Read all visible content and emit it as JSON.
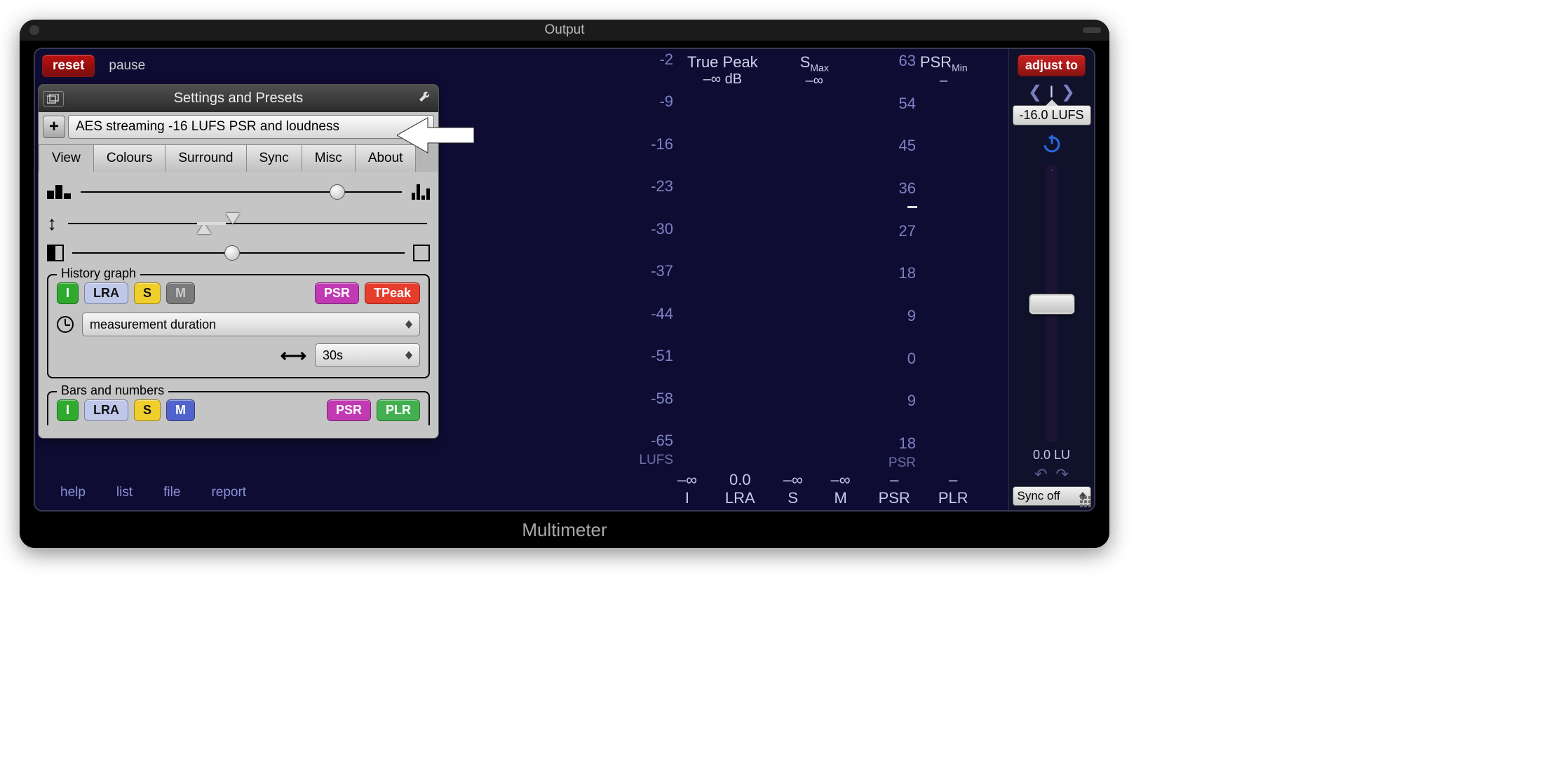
{
  "window": {
    "title": "Output",
    "footer": "Multimeter"
  },
  "top": {
    "reset": "reset",
    "pause": "pause"
  },
  "settings": {
    "header": "Settings and Presets",
    "preset": "AES streaming -16 LUFS PSR and loudness",
    "tabs": [
      "View",
      "Colours",
      "Surround",
      "Sync",
      "Misc",
      "About"
    ],
    "history_legend": "History graph",
    "bars_legend": "Bars and numbers",
    "chips1": {
      "I": "I",
      "LRA": "LRA",
      "S": "S",
      "M": "M",
      "PSR": "PSR",
      "TPeak": "TPeak"
    },
    "duration_label": "measurement duration",
    "duration_value": "30s",
    "chips2": {
      "I": "I",
      "LRA": "LRA",
      "S": "S",
      "M": "M",
      "PSR": "PSR",
      "PLR": "PLR"
    }
  },
  "stats": {
    "truepeak_label": "True Peak",
    "truepeak_value": "–∞ dB",
    "smax_label_prefix": "S",
    "smax_label_sub": "Max",
    "smax_value": "–∞",
    "psrmin_label_prefix": "PSR",
    "psrmin_label_sub": "Min",
    "psrmin_value": "–"
  },
  "axis_left": [
    "-2",
    "-9",
    "-16",
    "-23",
    "-30",
    "-37",
    "-44",
    "-51",
    "-58",
    "-65"
  ],
  "axis_left_unit": "LUFS",
  "axis_right": [
    "63",
    "54",
    "45",
    "36",
    "27",
    "18",
    "9",
    "0",
    "9",
    "18"
  ],
  "axis_right_unit": "PSR",
  "readouts": [
    {
      "v": "–∞",
      "l": "I"
    },
    {
      "v": "0.0",
      "l": "LRA"
    },
    {
      "v": "–∞",
      "l": "S"
    },
    {
      "v": "–∞",
      "l": "M"
    },
    {
      "v": "–",
      "l": "PSR"
    },
    {
      "v": "–",
      "l": "PLR"
    }
  ],
  "side": {
    "adjust": "adjust to",
    "target": "-16.0 LUFS",
    "target_letter": "I",
    "lu": "0.0 LU",
    "sync": "Sync off"
  },
  "links": [
    "help",
    "list",
    "file",
    "report"
  ]
}
